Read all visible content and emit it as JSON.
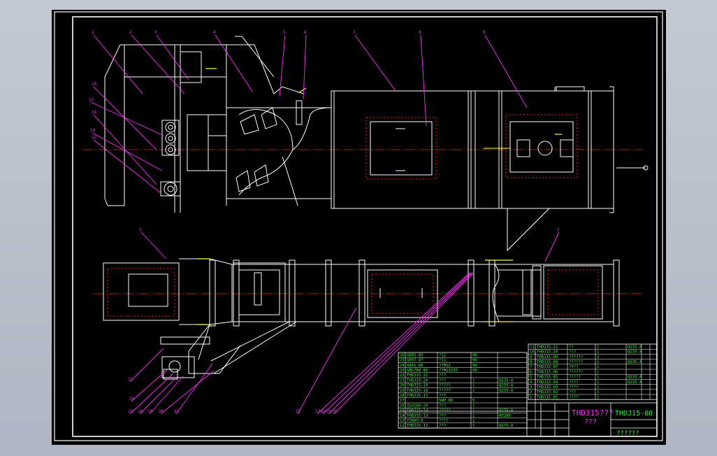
{
  "colors": {
    "frame": "#ffffff",
    "outline": "#ffffff",
    "centerline": "#ff2020",
    "leader": "#ff30ff",
    "table_line": "#ffffff",
    "table_text": "#33ff33",
    "title_text": "#ff30ff",
    "accent_yellow": "#ffff30"
  },
  "drawing": {
    "title_block": {
      "drawing_number": "THDJ15-00",
      "title_line1": "THD315???",
      "title_line2": "???",
      "company": "??????"
    },
    "callouts_top": [
      "1",
      "2",
      "3",
      "4",
      "5",
      "6",
      "7",
      "8",
      "9",
      "10",
      "11",
      "12",
      "13",
      "14"
    ],
    "callouts_bottom": [
      "1",
      "2",
      "15",
      "16",
      "17",
      "18",
      "19",
      "20",
      "21",
      "22",
      "23",
      "24",
      "25",
      "26"
    ],
    "bom_left": [
      {
        "no": "26",
        "code": "GB95-85",
        "name": "?12",
        "qty": "90",
        "mat": "",
        "a": "",
        "b": ""
      },
      {
        "no": "25",
        "code": "GB97-87",
        "name": "?12",
        "qty": "90",
        "mat": "",
        "a": "",
        "b": ""
      },
      {
        "no": "24",
        "code": "GB41-86",
        "name": "??M12",
        "qty": "90",
        "mat": "",
        "a": "",
        "b": ""
      },
      {
        "no": "23",
        "code": "GB5780-86",
        "name": "??M12X35",
        "qty": "90",
        "mat": "",
        "a": "",
        "b": ""
      },
      {
        "no": "22",
        "code": "THDJ15-21",
        "name": "???",
        "qty": "",
        "mat": "",
        "a": "",
        "b": ""
      },
      {
        "no": "21",
        "code": "THDJ15-20",
        "name": "???",
        "qty": "1",
        "mat": "Q235-A",
        "a": "",
        "b": ""
      },
      {
        "no": "20",
        "code": "THDJ15-19",
        "name": "?????",
        "qty": "1",
        "mat": "Q235-A",
        "a": "",
        "b": ""
      },
      {
        "no": "19",
        "code": "THDJ15-18",
        "name": "?????",
        "qty": "1",
        "mat": "Q235-A",
        "a": "",
        "b": ""
      },
      {
        "no": "18",
        "code": "THDJ15-17",
        "name": "???",
        "qty": "",
        "mat": "",
        "a": "",
        "b": ""
      },
      {
        "no": "17",
        "code": "",
        "name": "SWP 80",
        "qty": "5",
        "mat": "",
        "a": "",
        "b": ""
      },
      {
        "no": "16",
        "code": "ZLY180-20",
        "name": "???",
        "qty": "1",
        "mat": "",
        "a": "",
        "b": ""
      },
      {
        "no": "15",
        "code": "THDJ15-14",
        "name": "?????",
        "qty": "1",
        "mat": "Q235-A",
        "a": "",
        "b": ""
      },
      {
        "no": "14",
        "code": "THDJ15-13",
        "name": "???",
        "qty": "1",
        "mat": "HT200",
        "a": "",
        "b": ""
      },
      {
        "no": "13",
        "code": "Y280S-6",
        "name": "????",
        "qty": "1",
        "mat": "",
        "a": "",
        "b": ""
      },
      {
        "no": "12",
        "code": "THDJ15-12",
        "name": "???",
        "qty": "1",
        "mat": "Q275-A",
        "a": "",
        "b": ""
      }
    ],
    "bom_right": [
      {
        "no": "11",
        "code": "THDJ15-11",
        "name": "??",
        "qty": "1",
        "mat": "Q235-A",
        "a": "",
        "b": ""
      },
      {
        "no": "10",
        "code": "THDJ15-10",
        "name": "???",
        "qty": "1",
        "mat": "Q235-A",
        "a": "",
        "b": ""
      },
      {
        "no": "9",
        "code": "THDJ15-09",
        "name": "??????",
        "qty": "2",
        "mat": "",
        "a": "",
        "b": ""
      },
      {
        "no": "8",
        "code": "THDJ15-08",
        "name": "??????",
        "qty": "1",
        "mat": "Q235-A",
        "a": "",
        "b": ""
      },
      {
        "no": "7",
        "code": "THDJ15-07",
        "name": "????",
        "qty": "1",
        "mat": "",
        "a": "",
        "b": ""
      },
      {
        "no": "6",
        "code": "THDJ15-06",
        "name": "??????",
        "qty": "1",
        "mat": "",
        "a": "",
        "b": ""
      },
      {
        "no": "5",
        "code": "THDJ15-05",
        "name": "?????",
        "qty": "1",
        "mat": "Q235-A",
        "a": "",
        "b": ""
      },
      {
        "no": "4",
        "code": "THDJ15-04",
        "name": "????",
        "qty": "1",
        "mat": "Q235-A",
        "a": "",
        "b": ""
      },
      {
        "no": "3",
        "code": "THDJ15-03",
        "name": "????",
        "qty": "1",
        "mat": "",
        "a": "",
        "b": ""
      },
      {
        "no": "2",
        "code": "THDJ15-02",
        "name": "???",
        "qty": "1",
        "mat": "",
        "a": "",
        "b": ""
      },
      {
        "no": "1",
        "code": "THDJ15-01",
        "name": "????",
        "qty": "1",
        "mat": "",
        "a": "",
        "b": ""
      }
    ]
  }
}
